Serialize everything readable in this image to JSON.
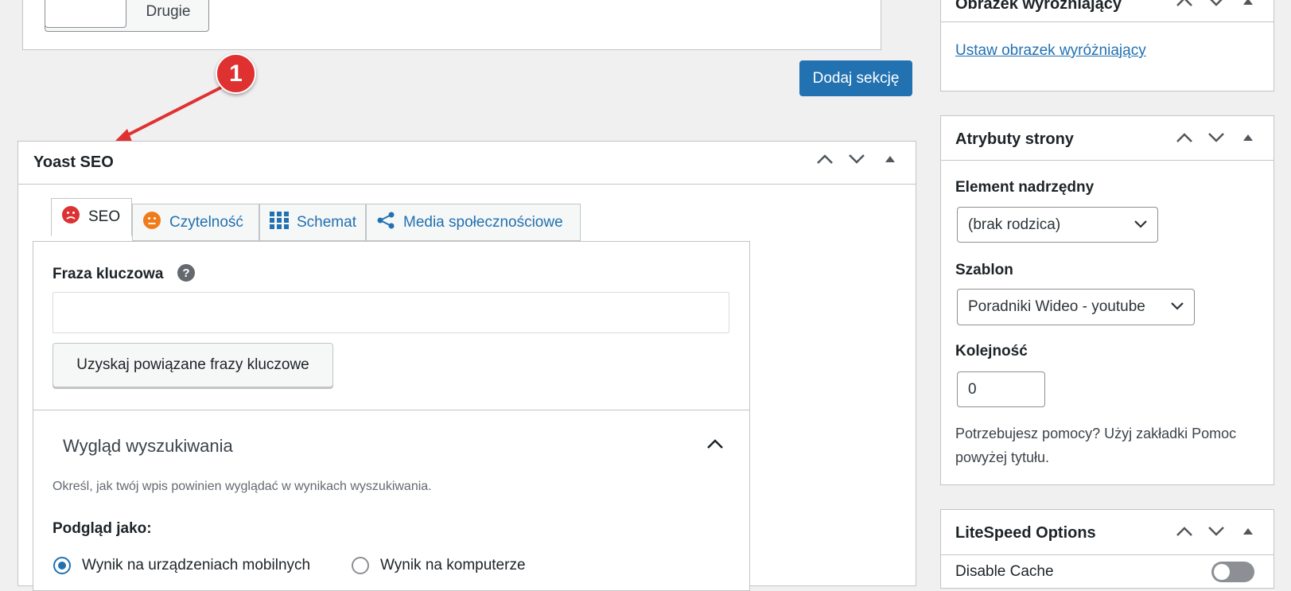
{
  "top_section": {
    "button_label": "Drugie",
    "add_section_label": "Dodaj sekcję"
  },
  "annotation": {
    "marker": "1"
  },
  "yoast": {
    "title": "Yoast SEO",
    "tabs": [
      {
        "label": "SEO",
        "icon": "sad-face-icon"
      },
      {
        "label": "Czytelność",
        "icon": "neutral-face-icon"
      },
      {
        "label": "Schemat",
        "icon": "grid-icon"
      },
      {
        "label": "Media społecznościowe",
        "icon": "share-icon"
      }
    ],
    "keyphrase_label": "Fraza kluczowa",
    "keyphrase_value": "",
    "related_button": "Uzyskaj powiązane frazy kluczowe",
    "search_appearance_title": "Wygląd wyszukiwania",
    "search_appearance_desc": "Określ, jak twój wpis powinien wyglądać w wynikach wyszukiwania.",
    "preview_label": "Podgląd jako:",
    "preview_options": [
      {
        "label": "Wynik na urządzeniach mobilnych",
        "selected": true
      },
      {
        "label": "Wynik na komputerze",
        "selected": false
      }
    ]
  },
  "sidebar": {
    "featured_image": {
      "title": "Obrazek wyróżniający",
      "link": "Ustaw obrazek wyróżniający"
    },
    "page_attributes": {
      "title": "Atrybuty strony",
      "parent_label": "Element nadrzędny",
      "parent_value": "(brak rodzica)",
      "template_label": "Szablon",
      "template_value": "Poradniki Wideo - youtube",
      "order_label": "Kolejność",
      "order_value": "0",
      "help_text": "Potrzebujesz pomocy? Użyj zakładki Pomoc powyżej tytułu."
    },
    "litespeed": {
      "title": "LiteSpeed Options",
      "disable_cache_label": "Disable Cache",
      "disable_cache_on": false
    }
  },
  "colors": {
    "accent": "#2271b1",
    "marker": "#e03131",
    "seo_bad": "#dc3232",
    "readability_ok": "#ee7c1b"
  }
}
